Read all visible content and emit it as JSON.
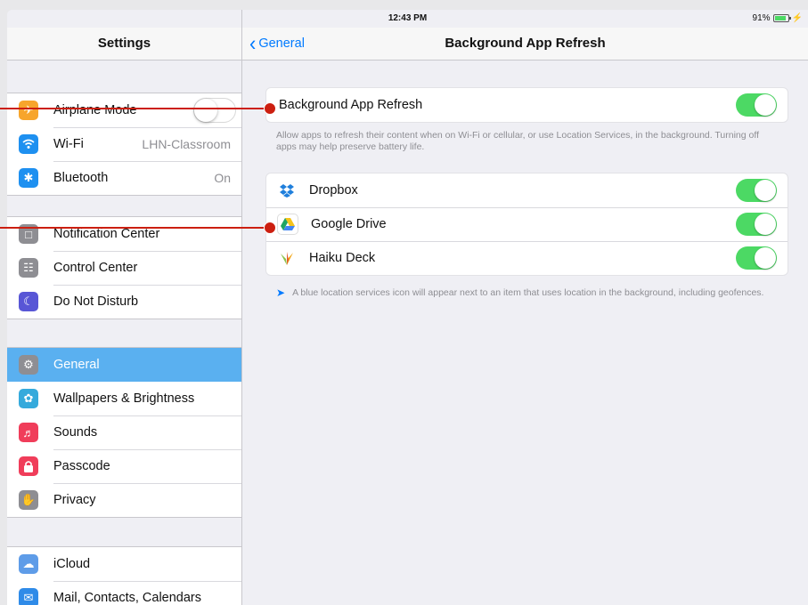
{
  "status_bar": {
    "device": "iPad",
    "time": "12:43 PM",
    "battery": "91%",
    "battery_level": 0.91
  },
  "left_pane": {
    "title": "Settings",
    "groups": [
      [
        {
          "label": "Airplane Mode",
          "icon": "airplane-icon",
          "color": "#f7a52c",
          "control": "toggle-off"
        },
        {
          "label": "Wi-Fi",
          "icon": "wifi-icon",
          "color": "#1e90f0",
          "value": "LHN-Classroom"
        },
        {
          "label": "Bluetooth",
          "icon": "bluetooth-icon",
          "color": "#1e90f0",
          "value": "On"
        }
      ],
      [
        {
          "label": "Notification Center",
          "icon": "notification-center-icon",
          "color": "#8e8e93"
        },
        {
          "label": "Control Center",
          "icon": "control-center-icon",
          "color": "#8e8e93"
        },
        {
          "label": "Do Not Disturb",
          "icon": "moon-icon",
          "color": "#5856d6"
        }
      ],
      [
        {
          "label": "General",
          "icon": "gear-icon",
          "color": "#8e8e93",
          "selected": true
        },
        {
          "label": "Wallpapers & Brightness",
          "icon": "flower-icon",
          "color": "#35aadc"
        },
        {
          "label": "Sounds",
          "icon": "speaker-icon",
          "color": "#f03d5a"
        },
        {
          "label": "Passcode",
          "icon": "lock-icon",
          "color": "#f03d5a"
        },
        {
          "label": "Privacy",
          "icon": "hand-icon",
          "color": "#8e8e93"
        }
      ],
      [
        {
          "label": "iCloud",
          "icon": "cloud-icon",
          "color": "#5e9ce8"
        },
        {
          "label": "Mail, Contacts, Calendars",
          "icon": "mail-icon",
          "color": "#2f8be8"
        }
      ]
    ]
  },
  "right_pane": {
    "back_label": "General",
    "title": "Background App Refresh",
    "master": {
      "label": "Background App Refresh",
      "on": true
    },
    "master_footer": "Allow apps to refresh their content when on Wi-Fi or cellular, or use Location Services, in the background. Turning off apps may help preserve battery life.",
    "apps": [
      {
        "label": "Dropbox",
        "icon": "dropbox-icon",
        "on": true
      },
      {
        "label": "Google Drive",
        "icon": "google-drive-icon",
        "on": true
      },
      {
        "label": "Haiku Deck",
        "icon": "haiku-deck-icon",
        "on": true
      }
    ],
    "apps_footer": "A blue location services icon will appear next to an item that uses location in the background, including geofences."
  },
  "colors": {
    "accent": "#007aff",
    "toggle_on": "#4cd964",
    "annotation": "#cc1f10",
    "selected_row": "#5ab0f0"
  }
}
